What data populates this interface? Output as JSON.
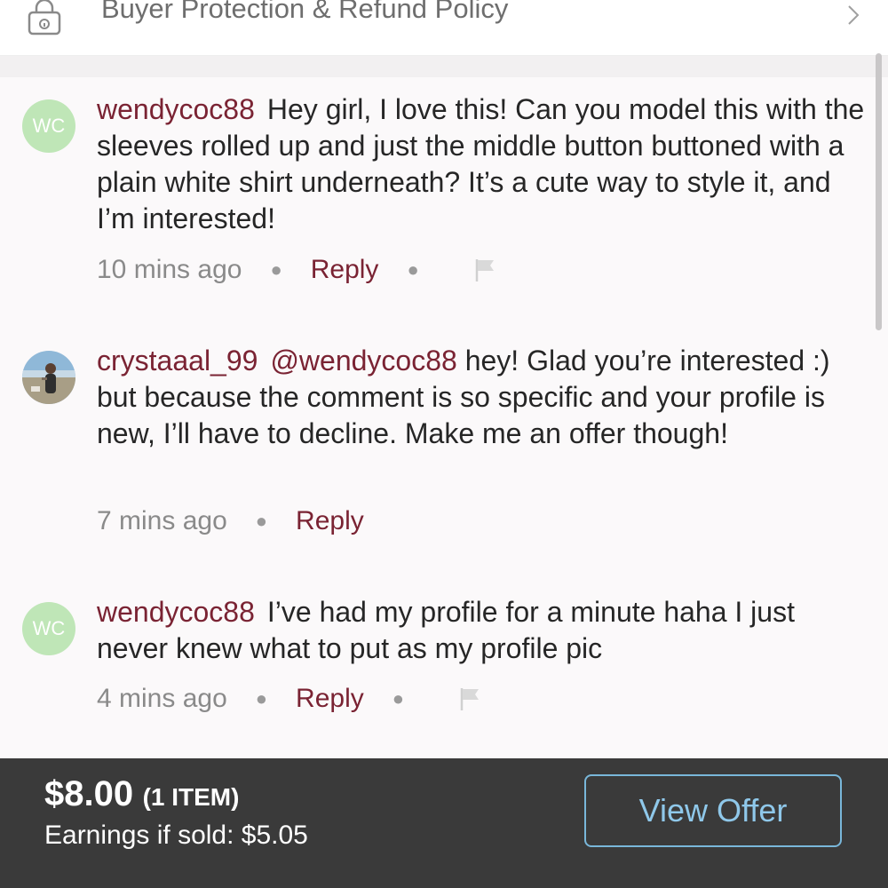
{
  "header": {
    "policy_label": "Buyer Protection & Refund Policy",
    "lock_icon": "lock-icon",
    "chevron_icon": "chevron-right-icon"
  },
  "comments": [
    {
      "avatar_initials": "WC",
      "username": "wendycoc88",
      "text": "Hey girl, I love this! Can you model this with the sleeves rolled up and just the middle button buttoned with a plain white shirt underneath? It’s a cute way to style it, and I’m interested!",
      "time": "10 mins ago",
      "reply_label": "Reply",
      "has_flag": true
    },
    {
      "avatar_initials": "",
      "username": "crystaaal_99",
      "mention": "@wendycoc88",
      "text": "hey! Glad you’re interested :) but because the comment is so specific and your profile is new, I’ll have to decline. Make me an offer though!",
      "time": "7 mins ago",
      "reply_label": "Reply",
      "has_flag": false
    },
    {
      "avatar_initials": "WC",
      "username": "wendycoc88",
      "text": "I’ve had my profile for a minute haha I just never knew what to put as my profile pic",
      "time": "4 mins ago",
      "reply_label": "Reply",
      "has_flag": true
    }
  ],
  "footer": {
    "price": "$8.00",
    "items": "(1 ITEM)",
    "earnings_label": "Earnings if sold:",
    "earnings_value": "$5.05",
    "offer_button": "View Offer"
  },
  "colors": {
    "accent_username": "#7a2333",
    "offer_button": "#8fc8ea",
    "footer_bg": "#3a3a3a",
    "avatar_bg": "#bfe6b7"
  }
}
